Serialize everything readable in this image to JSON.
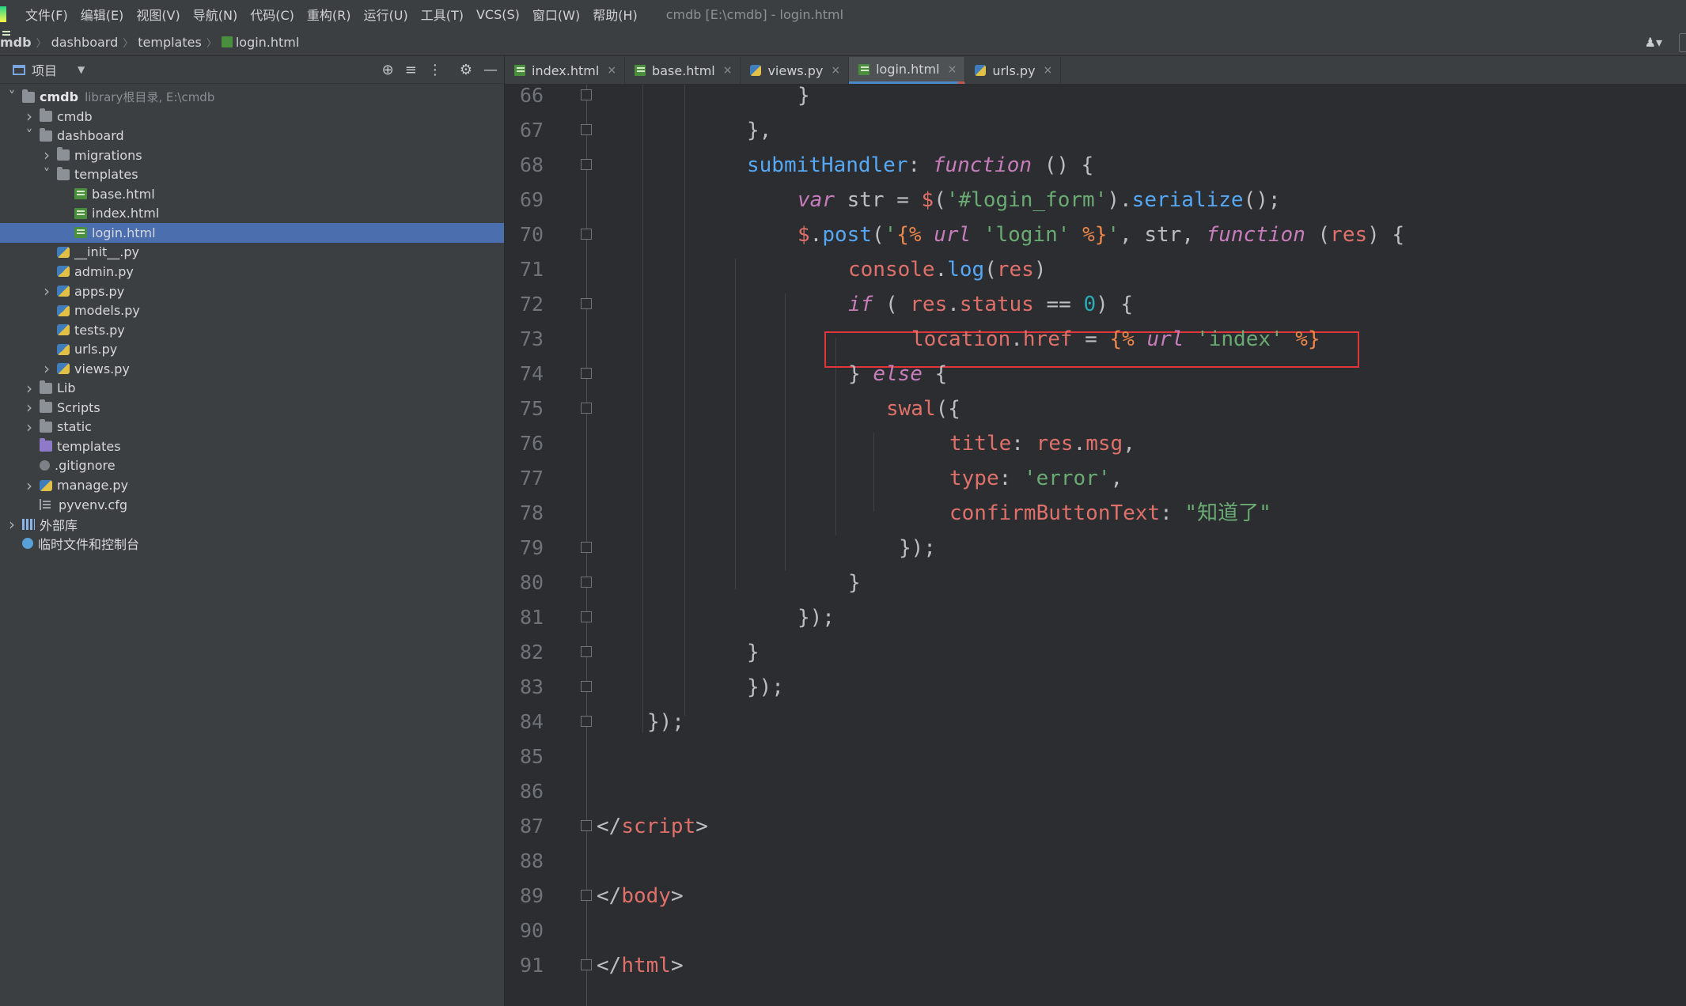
{
  "menubar": {
    "items": [
      "文件(F)",
      "编辑(E)",
      "视图(V)",
      "导航(N)",
      "代码(C)",
      "重构(R)",
      "运行(U)",
      "工具(T)",
      "VCS(S)",
      "窗口(W)",
      "帮助(H)"
    ],
    "window_title": "cmdb [E:\\cmdb] - login.html"
  },
  "breadcrumb": {
    "items": [
      "mdb",
      "dashboard",
      "templates",
      "login.html"
    ]
  },
  "project_panel": {
    "title": "项目",
    "tree": [
      {
        "label": "cmdb",
        "hint": "library根目录, E:\\cmdb",
        "icon": "folder-icon",
        "chevron": "open",
        "depth": 0,
        "bold": true
      },
      {
        "label": "cmdb",
        "icon": "folder-icon",
        "chevron": "closed",
        "depth": 1
      },
      {
        "label": "dashboard",
        "icon": "folder-icon",
        "chevron": "open",
        "depth": 1
      },
      {
        "label": "migrations",
        "icon": "folder-icon",
        "chevron": "closed",
        "depth": 2
      },
      {
        "label": "templates",
        "icon": "folder-icon",
        "chevron": "open",
        "depth": 2
      },
      {
        "label": "base.html",
        "icon": "html-file-icon",
        "chevron": "none",
        "depth": 3
      },
      {
        "label": "index.html",
        "icon": "html-file-icon",
        "chevron": "none",
        "depth": 3
      },
      {
        "label": "login.html",
        "icon": "html-file-icon",
        "chevron": "none",
        "depth": 3,
        "selected": true
      },
      {
        "label": "__init__.py",
        "icon": "python-file-icon",
        "chevron": "none",
        "depth": 2
      },
      {
        "label": "admin.py",
        "icon": "python-file-icon",
        "chevron": "none",
        "depth": 2
      },
      {
        "label": "apps.py",
        "icon": "python-file-icon",
        "chevron": "closed",
        "depth": 2
      },
      {
        "label": "models.py",
        "icon": "python-file-icon",
        "chevron": "none",
        "depth": 2
      },
      {
        "label": "tests.py",
        "icon": "python-file-icon",
        "chevron": "none",
        "depth": 2
      },
      {
        "label": "urls.py",
        "icon": "python-file-icon",
        "chevron": "none",
        "depth": 2
      },
      {
        "label": "views.py",
        "icon": "python-file-icon",
        "chevron": "closed",
        "depth": 2
      },
      {
        "label": "Lib",
        "icon": "folder-icon",
        "chevron": "closed",
        "depth": 1
      },
      {
        "label": "Scripts",
        "icon": "folder-icon",
        "chevron": "closed",
        "depth": 1
      },
      {
        "label": "static",
        "icon": "folder-icon",
        "chevron": "closed",
        "depth": 1
      },
      {
        "label": "templates",
        "icon": "templates-folder-icon",
        "chevron": "none",
        "depth": 1
      },
      {
        "label": ".gitignore",
        "icon": "gitignore-file-icon",
        "chevron": "none",
        "depth": 1
      },
      {
        "label": "manage.py",
        "icon": "python-file-icon",
        "chevron": "closed",
        "depth": 1
      },
      {
        "label": "pyvenv.cfg",
        "icon": "config-file-icon",
        "chevron": "none",
        "depth": 1
      },
      {
        "label": "外部库",
        "icon": "external-libraries-icon",
        "chevron": "closed",
        "depth": 0
      },
      {
        "label": "临时文件和控制台",
        "icon": "scratches-icon",
        "chevron": "none",
        "depth": 0
      }
    ]
  },
  "tabs": [
    {
      "label": "index.html",
      "icon": "html-file-icon",
      "active": false
    },
    {
      "label": "base.html",
      "icon": "html-file-icon",
      "active": false
    },
    {
      "label": "views.py",
      "icon": "python-file-icon",
      "active": false
    },
    {
      "label": "login.html",
      "icon": "html-file-icon",
      "active": true
    },
    {
      "label": "urls.py",
      "icon": "python-file-icon",
      "active": false
    }
  ],
  "editor": {
    "line_numbers": [
      "66",
      "67",
      "68",
      "69",
      "70",
      "71",
      "72",
      "73",
      "74",
      "75",
      "76",
      "77",
      "78",
      "79",
      "80",
      "81",
      "82",
      "83",
      "84",
      "85",
      "86",
      "87",
      "88",
      "89",
      "90",
      "91"
    ],
    "highlighted_line": "73",
    "lines": {
      "l66": [
        "}"
      ],
      "l67": [
        "},"
      ],
      "l68": [
        "submitHandler",
        ": ",
        "function",
        " () {"
      ],
      "l69": [
        "var",
        " str = ",
        "$",
        "(",
        "'#login_form'",
        ").",
        "serialize",
        "();"
      ],
      "l70": [
        "$",
        ".",
        "post",
        "(",
        "'",
        "{%",
        " url ",
        "'login'",
        " %}",
        "'",
        ", str, ",
        "function",
        " (",
        "res",
        ") {"
      ],
      "l71": [
        "console",
        ".",
        "log",
        "(",
        "res",
        ")"
      ],
      "l72": [
        "if",
        " ( ",
        "res",
        ".",
        "status",
        " == ",
        "0",
        ") {"
      ],
      "l73": [
        "location",
        ".",
        "href",
        " = ",
        "{%",
        " url ",
        "'index'",
        " %}"
      ],
      "l74": [
        "} ",
        "else",
        " {"
      ],
      "l75": [
        "swal",
        "({"
      ],
      "l76": [
        "title",
        ": ",
        "res",
        ".",
        "msg",
        ","
      ],
      "l77": [
        "type",
        ": ",
        "'error'",
        ","
      ],
      "l78": [
        "confirmButtonText",
        ": ",
        "\"知道了\""
      ],
      "l79": [
        "});"
      ],
      "l80": [
        "}"
      ],
      "l81": [
        "});"
      ],
      "l82": [
        "}"
      ],
      "l83": [
        "});"
      ],
      "l84": [
        "});"
      ],
      "l87": [
        "</",
        "script",
        ">"
      ],
      "l89": [
        "</",
        "body",
        ">"
      ],
      "l91": [
        "</",
        "html",
        ">"
      ]
    }
  },
  "colors": {
    "keyword": "#c77dbb",
    "string": "#6aab73",
    "function": "#56a8f5",
    "identifier_red": "#e0706a",
    "template_tag": "#ed864a",
    "highlight_box": "#e0363a",
    "selection": "#4b6eaf"
  }
}
